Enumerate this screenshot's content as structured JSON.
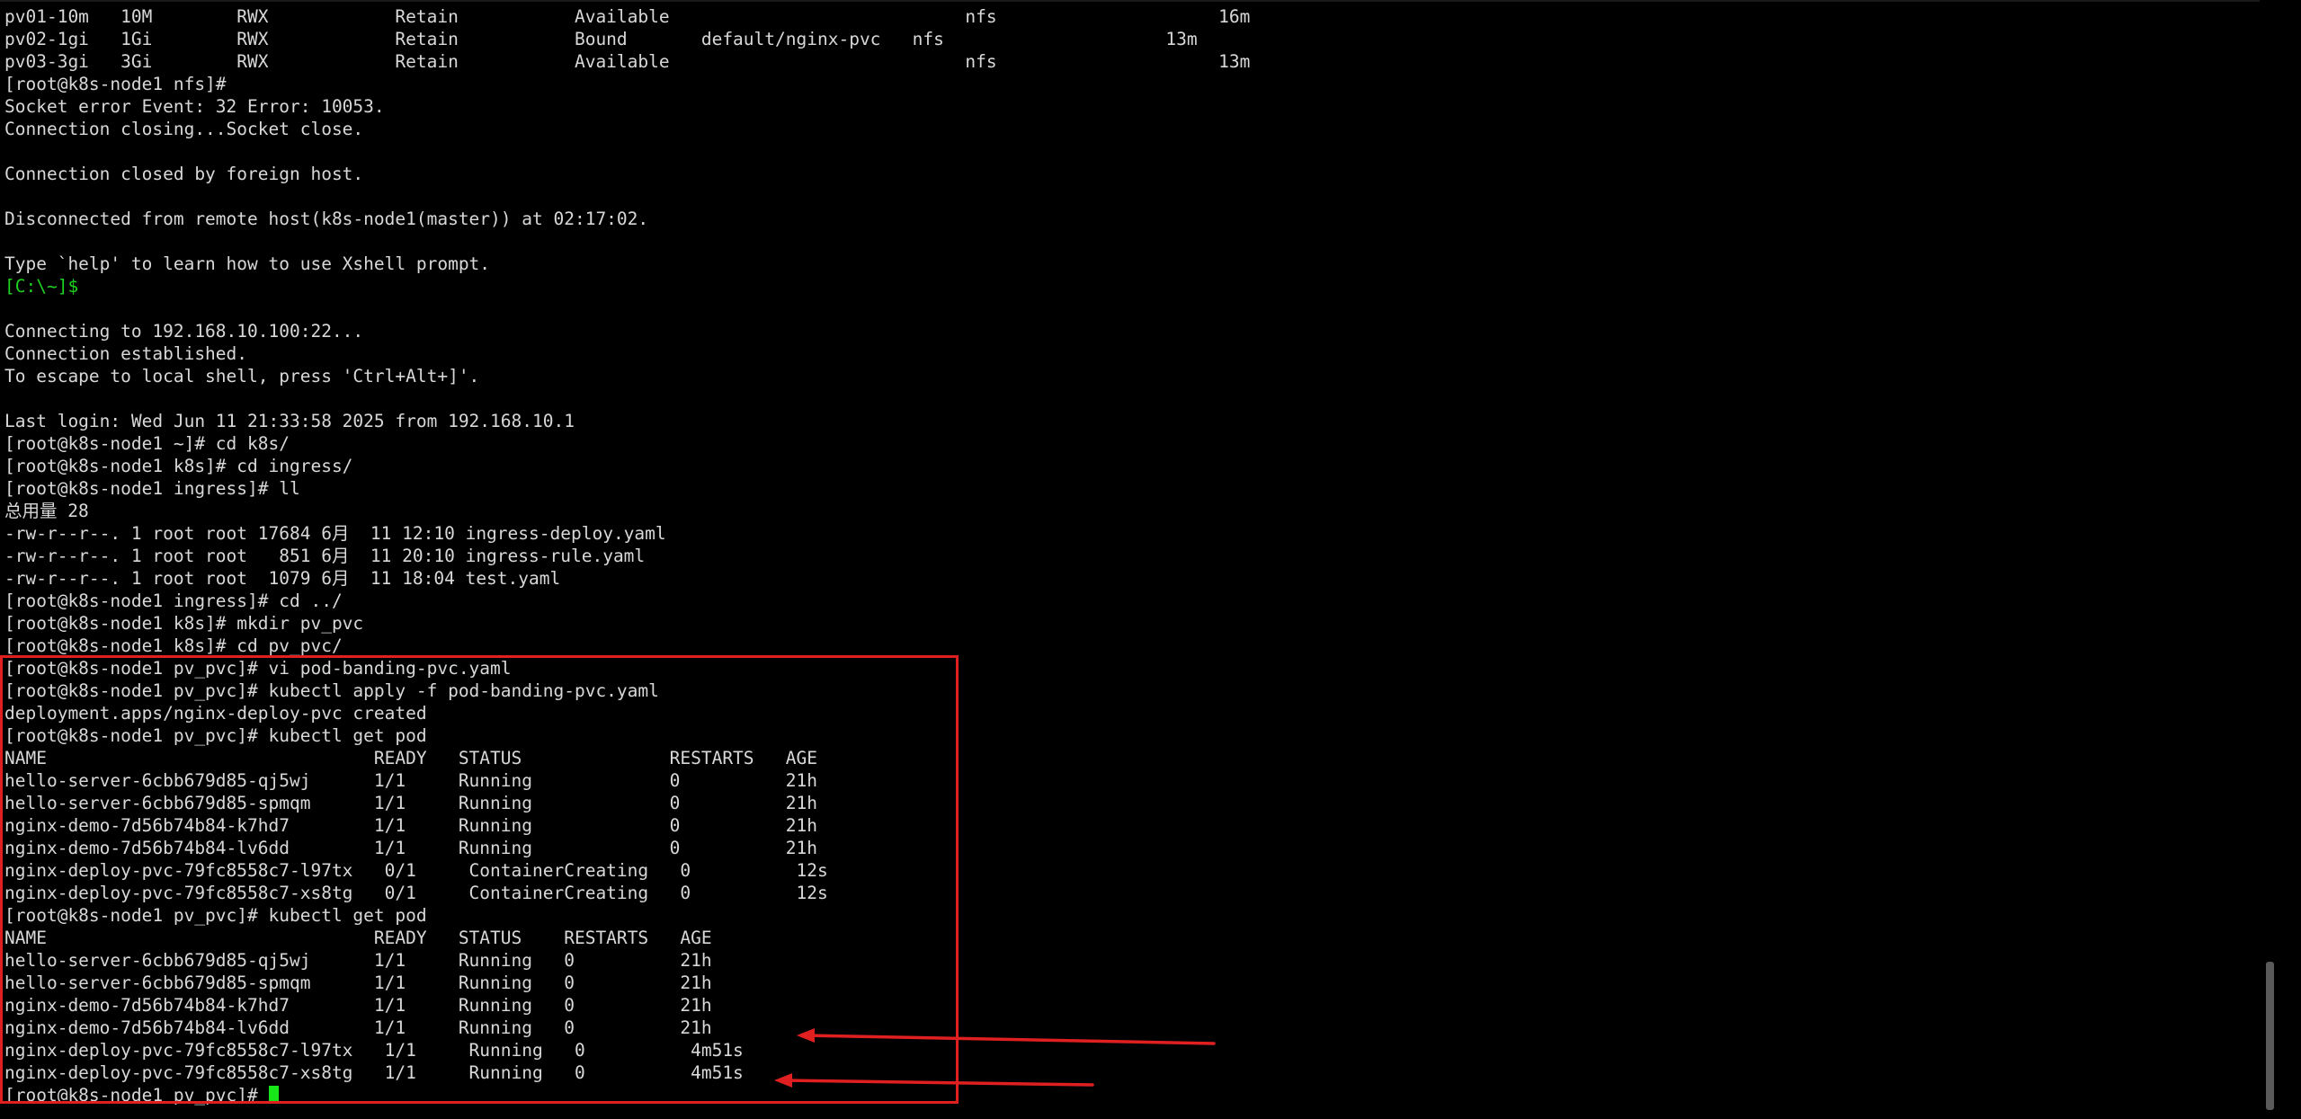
{
  "terminal": {
    "lines": [
      "pv01-10m   10M        RWX            Retain           Available                            nfs                     16m",
      "pv02-1gi   1Gi        RWX            Retain           Bound       default/nginx-pvc   nfs                     13m",
      "pv03-3gi   3Gi        RWX            Retain           Available                            nfs                     13m",
      "[root@k8s-node1 nfs]#",
      "Socket error Event: 32 Error: 10053.",
      "Connection closing...Socket close.",
      "",
      "Connection closed by foreign host.",
      "",
      "Disconnected from remote host(k8s-node1(master)) at 02:17:02.",
      "",
      "Type `help' to learn how to use Xshell prompt.",
      "[C:\\~]$",
      "",
      "Connecting to 192.168.10.100:22...",
      "Connection established.",
      "To escape to local shell, press 'Ctrl+Alt+]'.",
      "",
      "Last login: Wed Jun 11 21:33:58 2025 from 192.168.10.1",
      "[root@k8s-node1 ~]# cd k8s/",
      "[root@k8s-node1 k8s]# cd ingress/",
      "[root@k8s-node1 ingress]# ll",
      "总用量 28",
      "-rw-r--r--. 1 root root 17684 6月  11 12:10 ingress-deploy.yaml",
      "-rw-r--r--. 1 root root   851 6月  11 20:10 ingress-rule.yaml",
      "-rw-r--r--. 1 root root  1079 6月  11 18:04 test.yaml",
      "[root@k8s-node1 ingress]# cd ../",
      "[root@k8s-node1 k8s]# mkdir pv_pvc",
      "[root@k8s-node1 k8s]# cd pv_pvc/",
      "[root@k8s-node1 pv_pvc]# vi pod-banding-pvc.yaml",
      "[root@k8s-node1 pv_pvc]# kubectl apply -f pod-banding-pvc.yaml",
      "deployment.apps/nginx-deploy-pvc created",
      "[root@k8s-node1 pv_pvc]# kubectl get pod",
      "NAME                               READY   STATUS              RESTARTS   AGE",
      "hello-server-6cbb679d85-qj5wj      1/1     Running             0          21h",
      "hello-server-6cbb679d85-spmqm      1/1     Running             0          21h",
      "nginx-demo-7d56b74b84-k7hd7        1/1     Running             0          21h",
      "nginx-demo-7d56b74b84-lv6dd        1/1     Running             0          21h",
      "nginx-deploy-pvc-79fc8558c7-l97tx   0/1     ContainerCreating   0          12s",
      "nginx-deploy-pvc-79fc8558c7-xs8tg   0/1     ContainerCreating   0          12s",
      "[root@k8s-node1 pv_pvc]# kubectl get pod",
      "NAME                               READY   STATUS    RESTARTS   AGE",
      "hello-server-6cbb679d85-qj5wj      1/1     Running   0          21h",
      "hello-server-6cbb679d85-spmqm      1/1     Running   0          21h",
      "nginx-demo-7d56b74b84-k7hd7        1/1     Running   0          21h",
      "nginx-demo-7d56b74b84-lv6dd        1/1     Running   0          21h",
      "nginx-deploy-pvc-79fc8558c7-l97tx   1/1     Running   0          4m51s",
      "nginx-deploy-pvc-79fc8558c7-xs8tg   1/1     Running   0          4m51s",
      "[root@k8s-node1 pv_pvc]# "
    ],
    "green_line_index": 12,
    "cursor_line_index": 48,
    "colors": {
      "background": "#000000",
      "text": "#d8d8d8",
      "prompt_green": "#1fd11f",
      "cursor": "#19e619",
      "annotation_red": "#e02020"
    }
  }
}
